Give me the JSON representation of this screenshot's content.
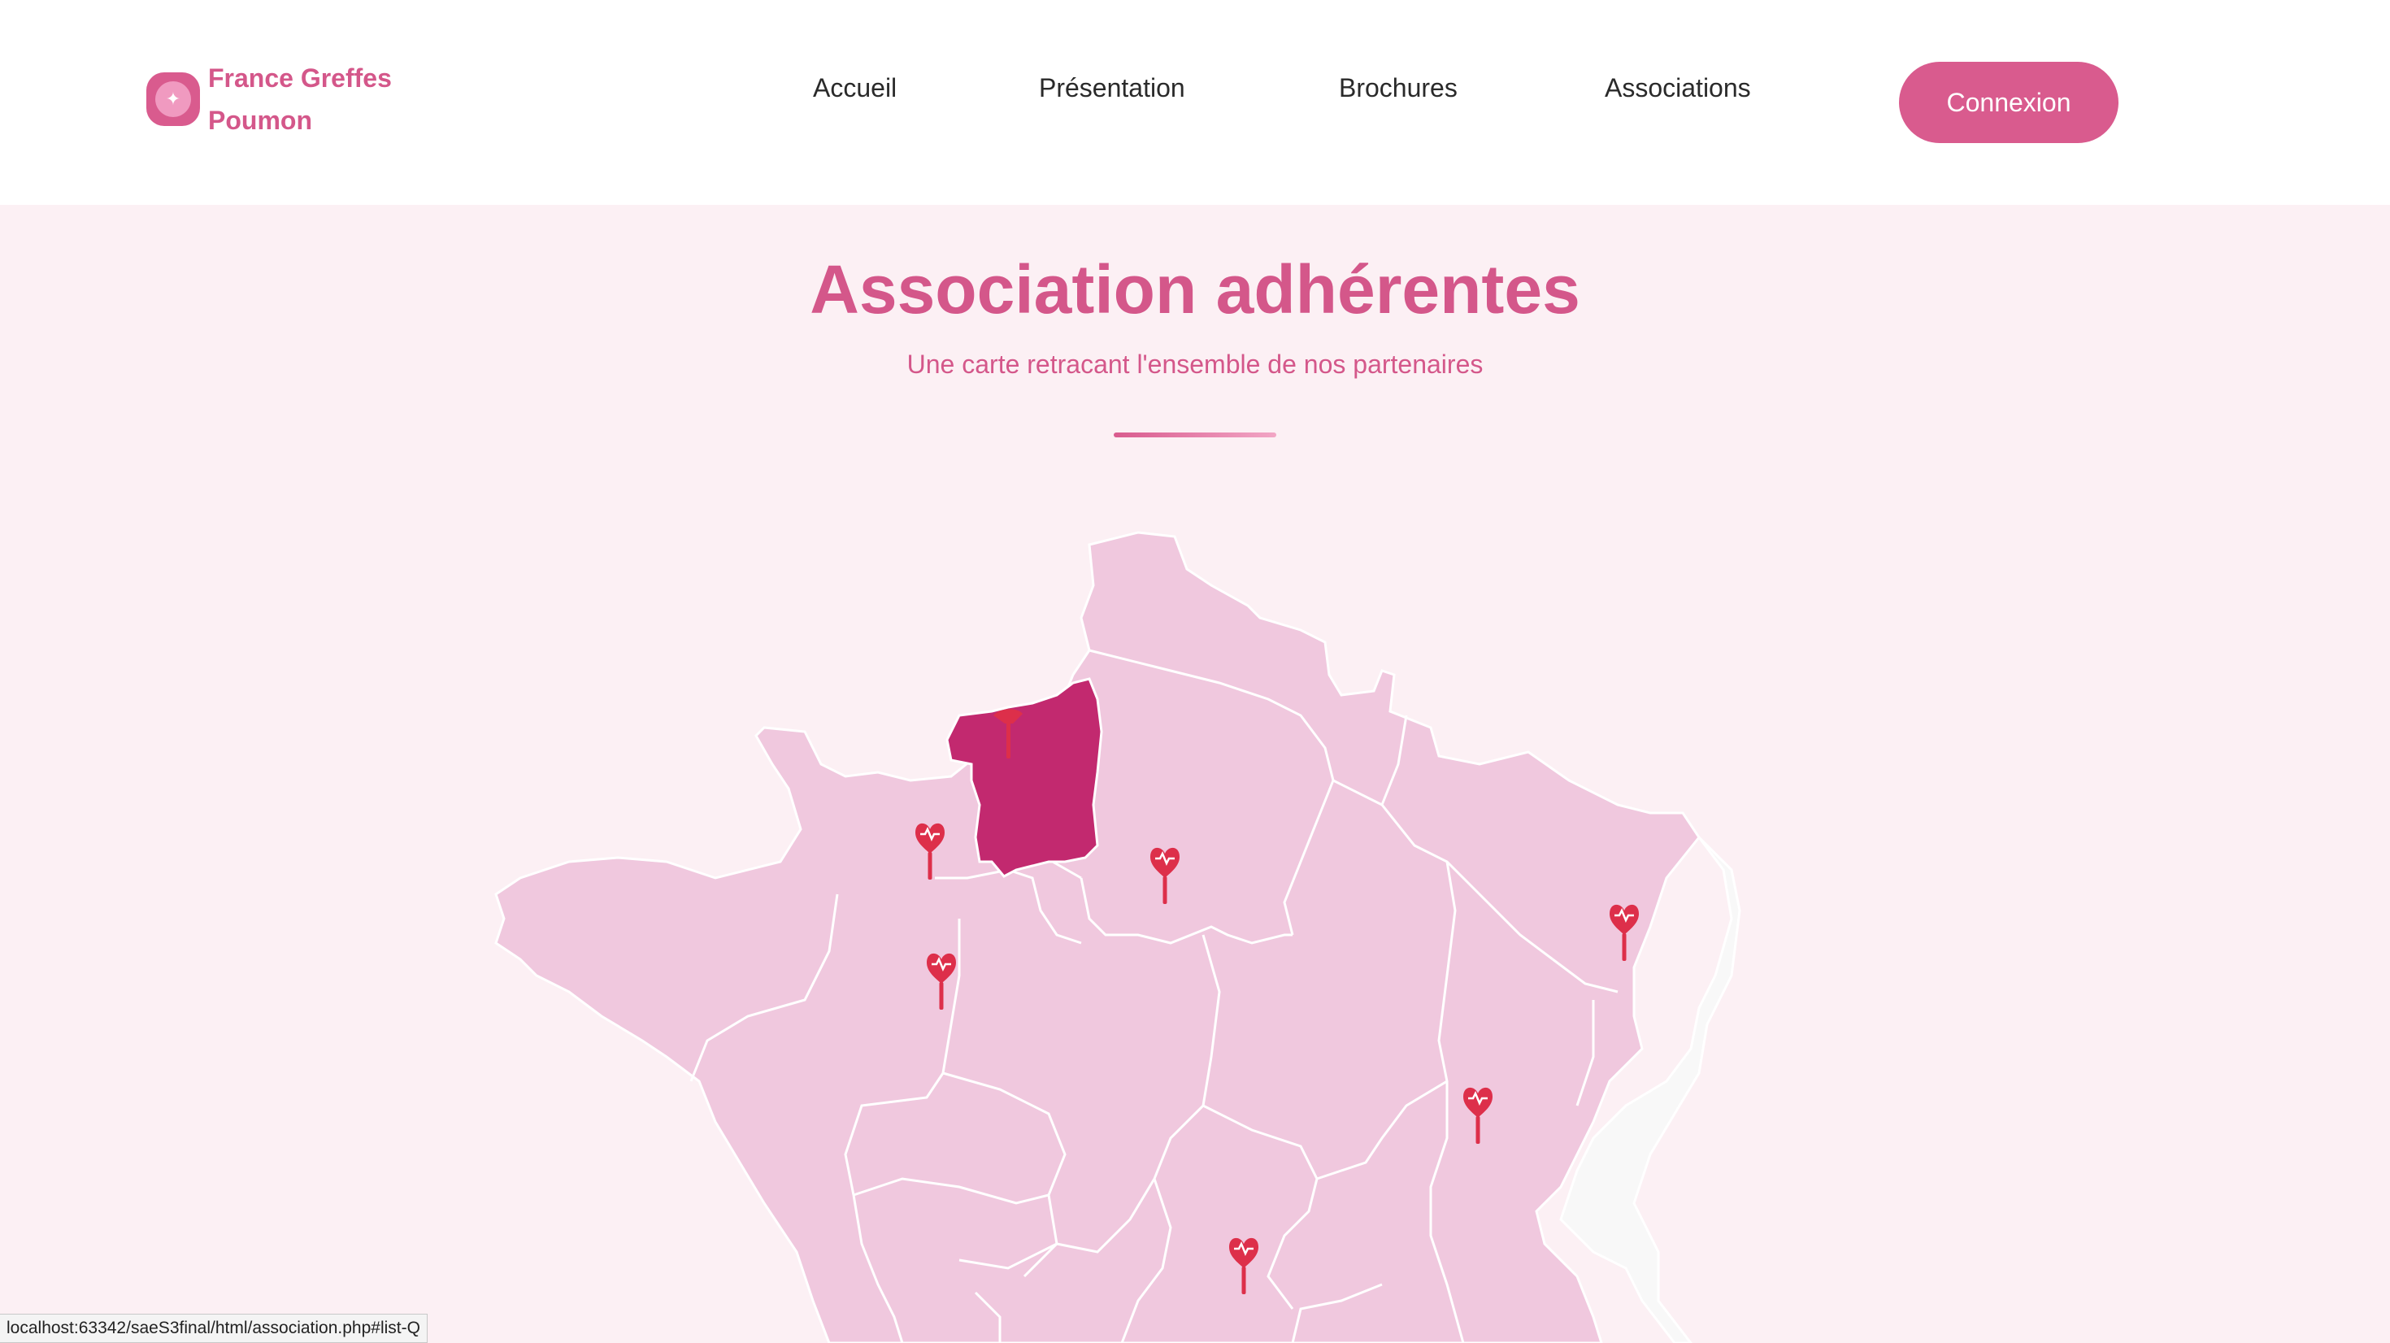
{
  "brand": {
    "name_line1": "France Greffes",
    "name_line2": "Poumon",
    "color": "#d4578a"
  },
  "nav": {
    "items": [
      {
        "label": "Accueil"
      },
      {
        "label": "Présentation"
      },
      {
        "label": "Brochures"
      },
      {
        "label": "Associations"
      }
    ],
    "login_label": "Connexion"
  },
  "hero": {
    "title": "Association adhérentes",
    "subtitle": "Une carte retracant l'ensemble de nos partenaires"
  },
  "map": {
    "highlight_color": "#c2296f",
    "region_color": "#f0c8de",
    "marker_color": "#dd2f4a",
    "marker_icon": "heart-lung-pin-icon",
    "marker_count": 8
  },
  "status": {
    "url": "localhost:63342/saeS3final/html/association.php#list-Q"
  }
}
